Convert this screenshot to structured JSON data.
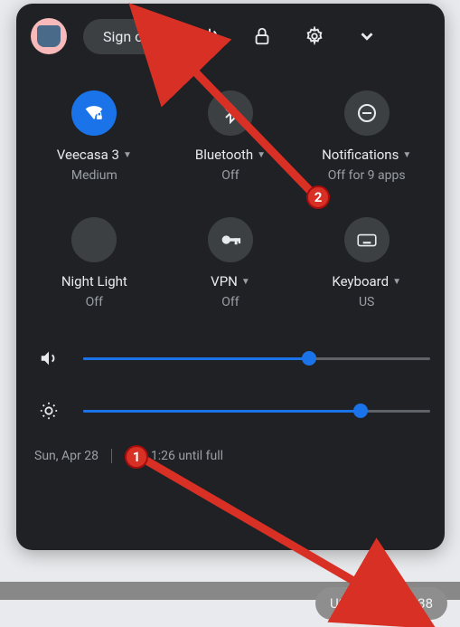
{
  "header": {
    "signout_label": "Sign out"
  },
  "tiles": {
    "wifi": {
      "label": "Veecasa 3",
      "sub": "Medium"
    },
    "bluetooth": {
      "label": "Bluetooth",
      "sub": "Off"
    },
    "notifications": {
      "label": "Notifications",
      "sub": "Off for 9 apps"
    },
    "nightlight": {
      "label": "Night Light",
      "sub": "Off"
    },
    "vpn": {
      "label": "VPN",
      "sub": "Off"
    },
    "keyboard": {
      "label": "Keyboard",
      "sub": "US"
    }
  },
  "sliders": {
    "volume_percent": 65,
    "brightness_percent": 80
  },
  "footer": {
    "date": "Sun, Apr 28",
    "battery": "1% - 1:26 until full"
  },
  "tray": {
    "keyboard_label": "US",
    "time": "09:38"
  },
  "annotations": {
    "badge1": "1",
    "badge2": "2"
  }
}
